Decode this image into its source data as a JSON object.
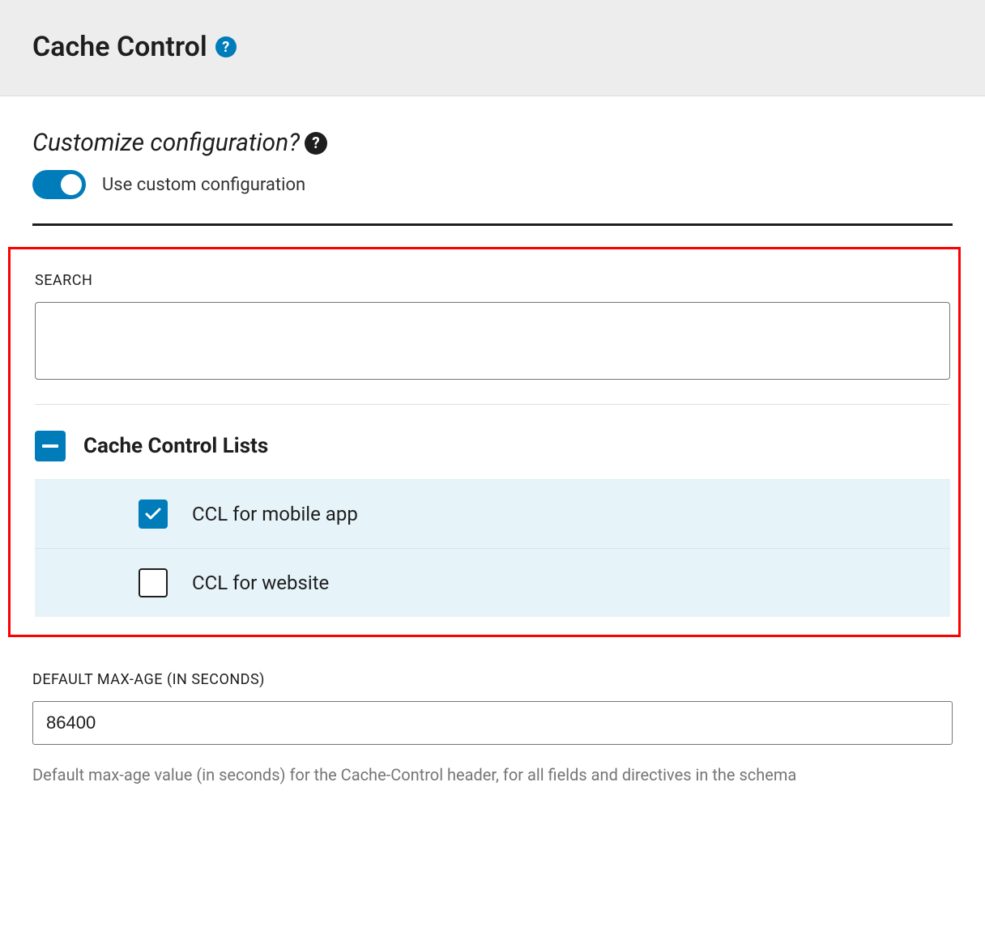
{
  "header": {
    "title": "Cache Control"
  },
  "configToggle": {
    "heading": "Customize configuration?",
    "label": "Use custom configuration",
    "enabled": true
  },
  "search": {
    "label": "SEARCH",
    "value": ""
  },
  "listGroup": {
    "title": "Cache Control Lists",
    "items": [
      {
        "label": "CCL for mobile app",
        "checked": true
      },
      {
        "label": "CCL for website",
        "checked": false
      }
    ]
  },
  "maxAge": {
    "label": "DEFAULT MAX-AGE (IN SECONDS)",
    "value": "86400",
    "help": "Default max-age value (in seconds) for the Cache-Control header, for all fields and directives in the schema"
  }
}
